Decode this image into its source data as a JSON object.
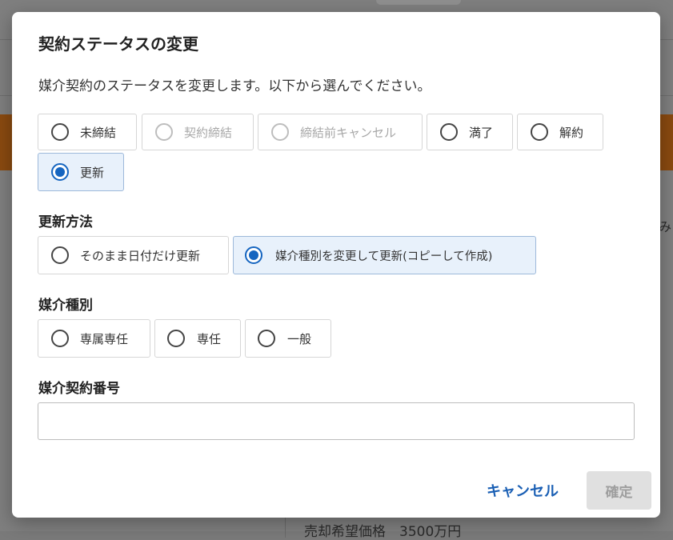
{
  "background": {
    "side_glyph": "み",
    "bottom_text": "売却希望価格　3500万円"
  },
  "dialog": {
    "title": "契約ステータスの変更",
    "description": "媒介契約のステータスを変更します。以下から選んでください。",
    "status_options": [
      {
        "label": "未締結",
        "selected": false,
        "disabled": false
      },
      {
        "label": "契約締結",
        "selected": false,
        "disabled": true
      },
      {
        "label": "締結前キャンセル",
        "selected": false,
        "disabled": true
      },
      {
        "label": "満了",
        "selected": false,
        "disabled": false
      },
      {
        "label": "解約",
        "selected": false,
        "disabled": false
      },
      {
        "label": "更新",
        "selected": true,
        "disabled": false
      }
    ],
    "renewal_method": {
      "label": "更新方法",
      "options": [
        {
          "label": "そのまま日付だけ更新",
          "selected": false
        },
        {
          "label": "媒介種別を変更して更新(コピーして作成)",
          "selected": true
        }
      ]
    },
    "mediation_type": {
      "label": "媒介種別",
      "options": [
        {
          "label": "専属専任",
          "selected": false
        },
        {
          "label": "専任",
          "selected": false
        },
        {
          "label": "一般",
          "selected": false
        }
      ]
    },
    "contract_number": {
      "label": "媒介契約番号",
      "value": "",
      "placeholder": ""
    },
    "cancel_label": "キャンセル",
    "confirm_label": "確定"
  },
  "colors": {
    "accent": "#1565c0",
    "selected_bg": "#e8f1fb",
    "disabled_text": "#a8a8a8",
    "confirm_disabled_bg": "#e0e0e0",
    "overlay": "#7f7f7f"
  }
}
